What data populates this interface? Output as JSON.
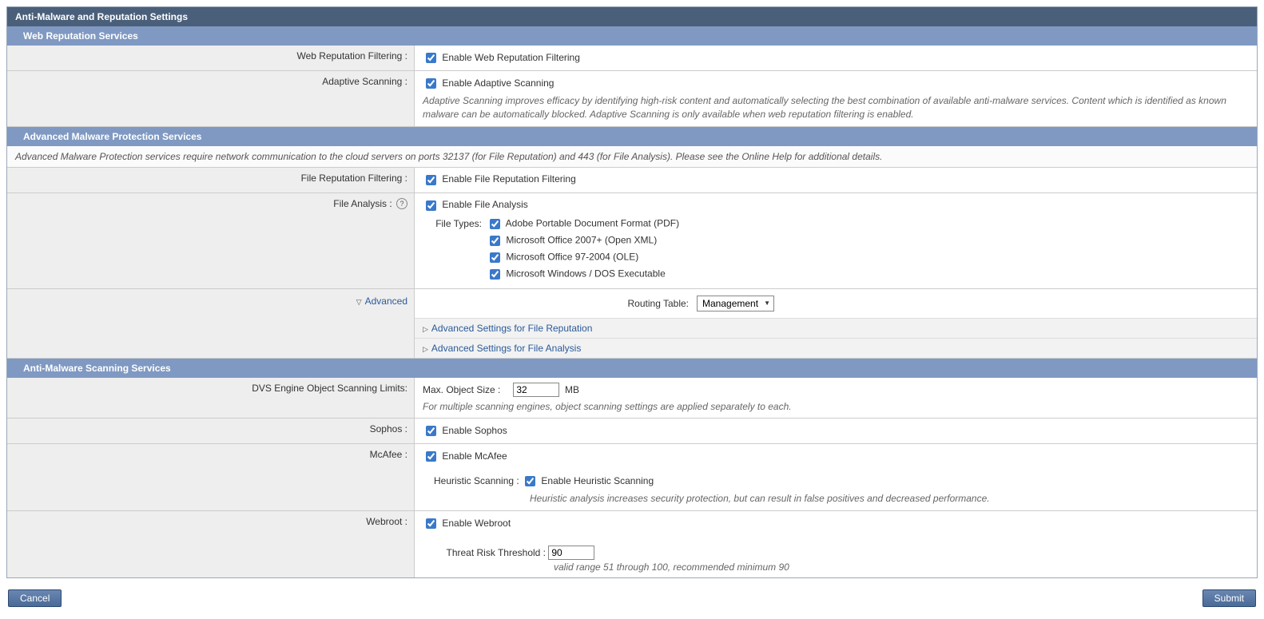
{
  "title": "Anti-Malware and Reputation Settings",
  "sections": {
    "wrs": {
      "header": "Web Reputation Services",
      "webRepFilter": {
        "label": "Web Reputation Filtering :",
        "cbLabel": "Enable Web Reputation Filtering"
      },
      "adaptive": {
        "label": "Adaptive Scanning :",
        "cbLabel": "Enable Adaptive Scanning",
        "hint": "Adaptive Scanning improves efficacy by identifying high-risk content and automatically selecting the best combination of available anti-malware services. Content which is identified as known malware can be automatically blocked. Adaptive Scanning is only available when web reputation filtering is enabled."
      }
    },
    "amps": {
      "header": "Advanced Malware Protection Services",
      "note": "Advanced Malware Protection services require network communication to the cloud servers on ports 32137 (for File Reputation) and 443 (for File Analysis). Please see the Online Help for additional details.",
      "fileRep": {
        "label": "File Reputation Filtering :",
        "cbLabel": "Enable File Reputation Filtering"
      },
      "fileAnalysis": {
        "label": "File Analysis :",
        "cbLabel": "Enable File Analysis",
        "ftLabel": "File Types:",
        "types": [
          "Adobe Portable Document Format (PDF)",
          "Microsoft Office 2007+ (Open XML)",
          "Microsoft Office 97-2004 (OLE)",
          "Microsoft Windows / DOS Executable"
        ]
      },
      "advanced": {
        "label": "Advanced",
        "routingLabel": "Routing Table:",
        "routingValue": "Management",
        "link1": "Advanced Settings for File Reputation",
        "link2": "Advanced Settings for File Analysis"
      }
    },
    "amss": {
      "header": "Anti-Malware Scanning Services",
      "dvs": {
        "label": "DVS Engine Object Scanning Limits:",
        "maxObjLabel": "Max. Object Size :",
        "maxObjValue": "32",
        "unit": "MB",
        "hint": "For multiple scanning engines, object scanning settings are applied separately to each."
      },
      "sophos": {
        "label": "Sophos :",
        "cbLabel": "Enable Sophos"
      },
      "mcafee": {
        "label": "McAfee :",
        "cbLabel": "Enable McAfee",
        "heurLabel": "Heuristic Scanning :",
        "heurCbLabel": "Enable Heuristic Scanning",
        "heurHint": "Heuristic analysis increases security protection, but can result in false positives and decreased performance."
      },
      "webroot": {
        "label": "Webroot :",
        "cbLabel": "Enable Webroot",
        "thrLabel": "Threat Risk Threshold :",
        "thrValue": "90",
        "thrHint": "valid range 51 through 100, recommended minimum 90"
      }
    }
  },
  "buttons": {
    "cancel": "Cancel",
    "submit": "Submit"
  }
}
